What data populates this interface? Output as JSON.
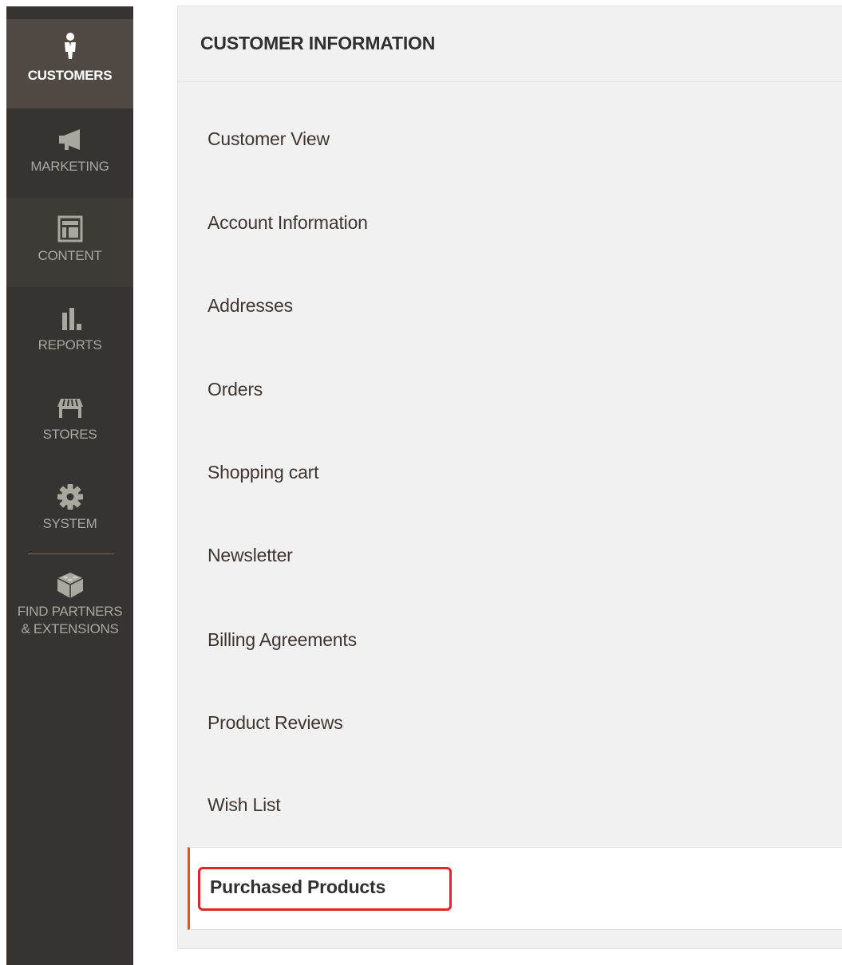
{
  "sidebar": {
    "items": [
      {
        "label": "CUSTOMERS",
        "icon": "customer-icon",
        "active": true
      },
      {
        "label": "MARKETING",
        "icon": "megaphone-icon"
      },
      {
        "label": "CONTENT",
        "icon": "layout-icon"
      },
      {
        "label": "REPORTS",
        "icon": "bar-chart-icon"
      },
      {
        "label": "STORES",
        "icon": "storefront-icon"
      },
      {
        "label": "SYSTEM",
        "icon": "gear-icon"
      },
      {
        "label_line1": "FIND PARTNERS",
        "label_line2": "& EXTENSIONS",
        "icon": "lego-brick-icon"
      }
    ]
  },
  "panel": {
    "title": "CUSTOMER INFORMATION",
    "menu": [
      {
        "label": "Customer View"
      },
      {
        "label": "Account Information"
      },
      {
        "label": "Addresses"
      },
      {
        "label": "Orders"
      },
      {
        "label": "Shopping cart"
      },
      {
        "label": "Newsletter"
      },
      {
        "label": "Billing Agreements"
      },
      {
        "label": "Product Reviews"
      },
      {
        "label": "Wish List"
      },
      {
        "label": "Purchased Products",
        "active": true
      }
    ]
  },
  "colors": {
    "sidebar_bg": "#373330",
    "sidebar_active_bg": "#514943",
    "accent": "#eb5202",
    "annotation": "#e22626"
  }
}
